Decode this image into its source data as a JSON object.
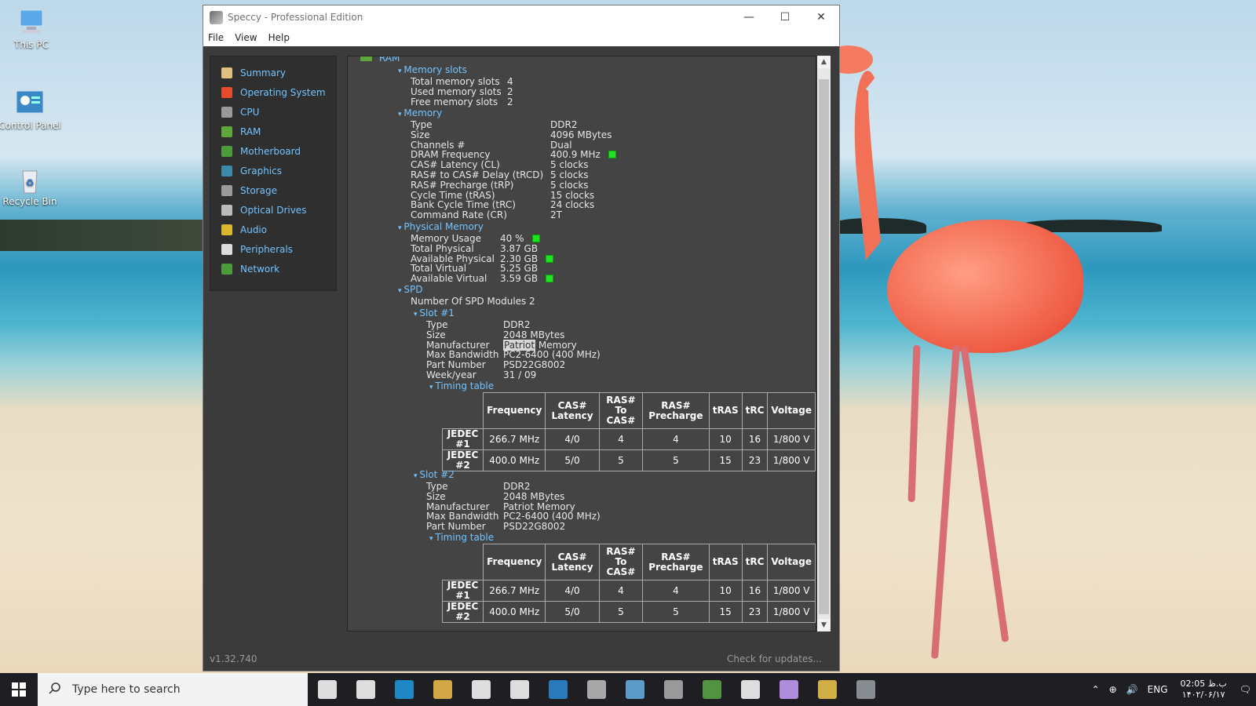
{
  "desktop": {
    "icons": [
      {
        "label": "This PC"
      },
      {
        "label": "Control Panel"
      },
      {
        "label": "Recycle Bin"
      }
    ]
  },
  "window": {
    "title": "Speccy - Professional Edition",
    "menu": [
      "File",
      "View",
      "Help"
    ],
    "version": "v1.32.740",
    "check_updates": "Check for updates..."
  },
  "sidebar": {
    "items": [
      {
        "label": "Summary",
        "icon": "summary-icon",
        "color": "#e0c080"
      },
      {
        "label": "Operating System",
        "icon": "windows-icon",
        "color": "#e84a2c"
      },
      {
        "label": "CPU",
        "icon": "cpu-icon",
        "color": "#9a9a9a"
      },
      {
        "label": "RAM",
        "icon": "ram-icon",
        "color": "#5fa63a"
      },
      {
        "label": "Motherboard",
        "icon": "motherboard-icon",
        "color": "#4d9a3a"
      },
      {
        "label": "Graphics",
        "icon": "graphics-icon",
        "color": "#3b8aa8"
      },
      {
        "label": "Storage",
        "icon": "storage-icon",
        "color": "#9a9a9a"
      },
      {
        "label": "Optical Drives",
        "icon": "optical-drive-icon",
        "color": "#bbbbbb"
      },
      {
        "label": "Audio",
        "icon": "audio-icon",
        "color": "#d9b830"
      },
      {
        "label": "Peripherals",
        "icon": "mouse-icon",
        "color": "#dddddd"
      },
      {
        "label": "Network",
        "icon": "network-icon",
        "color": "#4d9a3a"
      }
    ]
  },
  "content": {
    "root": "RAM",
    "memory_slots": {
      "heading": "Memory slots",
      "rows": [
        {
          "k": "Total memory slots",
          "v": "4"
        },
        {
          "k": "Used memory slots",
          "v": "2"
        },
        {
          "k": "Free memory slots",
          "v": "2"
        }
      ]
    },
    "memory": {
      "heading": "Memory",
      "rows": [
        {
          "k": "Type",
          "v": "DDR2"
        },
        {
          "k": "Size",
          "v": "4096 MBytes"
        },
        {
          "k": "Channels #",
          "v": "Dual"
        },
        {
          "k": "DRAM Frequency",
          "v": "400.9 MHz"
        },
        {
          "k": "CAS# Latency (CL)",
          "v": "5 clocks"
        },
        {
          "k": "RAS# to CAS# Delay (tRCD)",
          "v": "5 clocks"
        },
        {
          "k": "RAS# Precharge (tRP)",
          "v": "5 clocks"
        },
        {
          "k": "Cycle Time (tRAS)",
          "v": "15 clocks"
        },
        {
          "k": "Bank Cycle Time (tRC)",
          "v": "24 clocks"
        },
        {
          "k": "Command Rate (CR)",
          "v": "2T"
        }
      ]
    },
    "physical_memory": {
      "heading": "Physical Memory",
      "rows": [
        {
          "k": "Memory Usage",
          "v": "40 %"
        },
        {
          "k": "Total Physical",
          "v": "3.87 GB"
        },
        {
          "k": "Available Physical",
          "v": "2.30 GB"
        },
        {
          "k": "Total Virtual",
          "v": "5.25 GB"
        },
        {
          "k": "Available Virtual",
          "v": "3.59 GB"
        }
      ]
    },
    "spd": {
      "heading": "SPD",
      "modules_label": "Number Of SPD Modules",
      "modules_value": "2",
      "slot1": {
        "heading": "Slot #1",
        "rows": [
          {
            "k": "Type",
            "v": "DDR2"
          },
          {
            "k": "Size",
            "v": "2048 MBytes"
          },
          {
            "k": "Manufacturer",
            "v_hl": "Patriot",
            "v": " Memory"
          },
          {
            "k": "Max Bandwidth",
            "v": "PC2-6400 (400 MHz)"
          },
          {
            "k": "Part Number",
            "v": "PSD22G8002"
          },
          {
            "k": "Week/year",
            "v": "31 / 09"
          }
        ],
        "timing_heading": "Timing table"
      },
      "slot2": {
        "heading": "Slot #2",
        "rows": [
          {
            "k": "Type",
            "v": "DDR2"
          },
          {
            "k": "Size",
            "v": "2048 MBytes"
          },
          {
            "k": "Manufacturer",
            "v": "Patriot Memory"
          },
          {
            "k": "Max Bandwidth",
            "v": "PC2-6400 (400 MHz)"
          },
          {
            "k": "Part Number",
            "v": "PSD22G8002"
          }
        ],
        "timing_heading": "Timing table"
      },
      "timing": {
        "headers": [
          "Frequency",
          "CAS# Latency",
          "RAS# To CAS#",
          "RAS# Precharge",
          "tRAS",
          "tRC",
          "Voltage"
        ],
        "rows": [
          {
            "name": "JEDEC #1",
            "cells": [
              "266.7 MHz",
              "4/0",
              "4",
              "4",
              "10",
              "16",
              "1/800 V"
            ]
          },
          {
            "name": "JEDEC #2",
            "cells": [
              "400.0 MHz",
              "5/0",
              "5",
              "5",
              "15",
              "23",
              "1/800 V"
            ]
          }
        ]
      }
    }
  },
  "taskbar": {
    "search_placeholder": "Type here to search",
    "apps": [
      {
        "icon": "cortana-icon",
        "color": "#ffffff"
      },
      {
        "icon": "task-view-icon",
        "color": "#ffffff"
      },
      {
        "icon": "edge-icon",
        "color": "#1e9be0"
      },
      {
        "icon": "file-explorer-icon",
        "color": "#f2c14e"
      },
      {
        "icon": "store-icon",
        "color": "#ffffff"
      },
      {
        "icon": "mail-icon",
        "color": "#ffffff"
      },
      {
        "icon": "calculator-icon",
        "color": "#2a8bd6"
      },
      {
        "icon": "drive-icon",
        "color": "#bfbfbf"
      },
      {
        "icon": "tool-icon",
        "color": "#66b3e6"
      },
      {
        "icon": "archive-icon",
        "color": "#b0b0b0"
      },
      {
        "icon": "monitor-icon",
        "color": "#5aa845"
      },
      {
        "icon": "speccy-icon",
        "color": "#ffffff"
      },
      {
        "icon": "paint-icon",
        "color": "#c9a0ff"
      },
      {
        "icon": "player-icon",
        "color": "#f2c94c"
      },
      {
        "icon": "ccleaner-icon",
        "color": "#9aa0a6"
      }
    ],
    "language": "ENG",
    "time": "ب.ظ 02:05",
    "date": "۱۴۰۲/۰۶/۱۷"
  }
}
